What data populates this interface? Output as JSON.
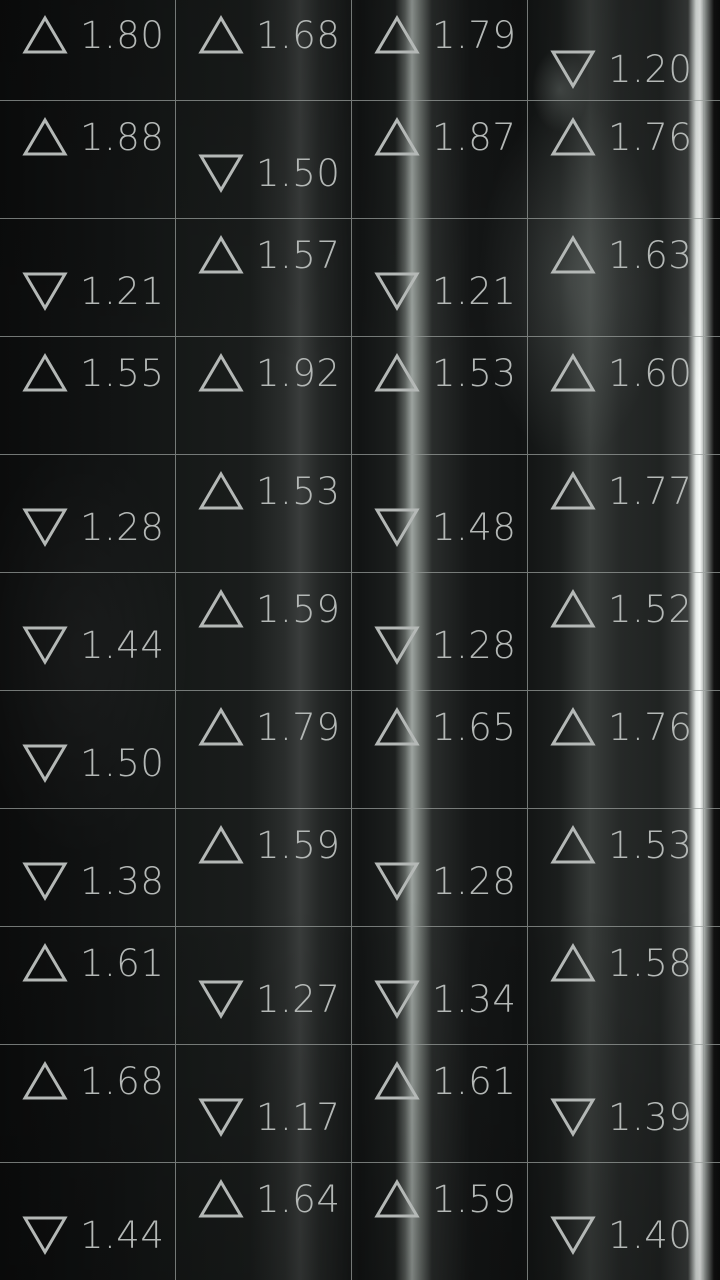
{
  "cells": [
    [
      {
        "dir": "up",
        "value": "1.80"
      },
      {
        "dir": "up",
        "value": "1.68"
      },
      {
        "dir": "up",
        "value": "1.79"
      },
      {
        "dir": "down",
        "value": "1.20"
      }
    ],
    [
      {
        "dir": "up",
        "value": "1.88"
      },
      {
        "dir": "down",
        "value": "1.50"
      },
      {
        "dir": "up",
        "value": "1.87"
      },
      {
        "dir": "up",
        "value": "1.76"
      }
    ],
    [
      {
        "dir": "down",
        "value": "1.21"
      },
      {
        "dir": "up",
        "value": "1.57"
      },
      {
        "dir": "down",
        "value": "1.21"
      },
      {
        "dir": "up",
        "value": "1.63"
      }
    ],
    [
      {
        "dir": "up",
        "value": "1.55"
      },
      {
        "dir": "up",
        "value": "1.92"
      },
      {
        "dir": "up",
        "value": "1.53"
      },
      {
        "dir": "up",
        "value": "1.60"
      }
    ],
    [
      {
        "dir": "down",
        "value": "1.28"
      },
      {
        "dir": "up",
        "value": "1.53"
      },
      {
        "dir": "down",
        "value": "1.48"
      },
      {
        "dir": "up",
        "value": "1.77"
      }
    ],
    [
      {
        "dir": "down",
        "value": "1.44"
      },
      {
        "dir": "up",
        "value": "1.59"
      },
      {
        "dir": "down",
        "value": "1.28"
      },
      {
        "dir": "up",
        "value": "1.52"
      }
    ],
    [
      {
        "dir": "down",
        "value": "1.50"
      },
      {
        "dir": "up",
        "value": "1.79"
      },
      {
        "dir": "up",
        "value": "1.65"
      },
      {
        "dir": "up",
        "value": "1.76"
      }
    ],
    [
      {
        "dir": "down",
        "value": "1.38"
      },
      {
        "dir": "up",
        "value": "1.59"
      },
      {
        "dir": "down",
        "value": "1.28"
      },
      {
        "dir": "up",
        "value": "1.53"
      }
    ],
    [
      {
        "dir": "up",
        "value": "1.61"
      },
      {
        "dir": "down",
        "value": "1.27"
      },
      {
        "dir": "down",
        "value": "1.34"
      },
      {
        "dir": "up",
        "value": "1.58"
      }
    ],
    [
      {
        "dir": "up",
        "value": "1.68"
      },
      {
        "dir": "down",
        "value": "1.17"
      },
      {
        "dir": "up",
        "value": "1.61"
      },
      {
        "dir": "down",
        "value": "1.39"
      }
    ],
    [
      {
        "dir": "down",
        "value": "1.44"
      },
      {
        "dir": "up",
        "value": "1.64"
      },
      {
        "dir": "up",
        "value": "1.59"
      },
      {
        "dir": "down",
        "value": "1.40"
      }
    ]
  ],
  "icons": {
    "up": "triangle-up-outline-icon",
    "down": "triangle-down-outline-icon"
  },
  "colors": {
    "text": "#b4b8b6",
    "grid": "#969b98",
    "background": "#0c0d0d"
  }
}
